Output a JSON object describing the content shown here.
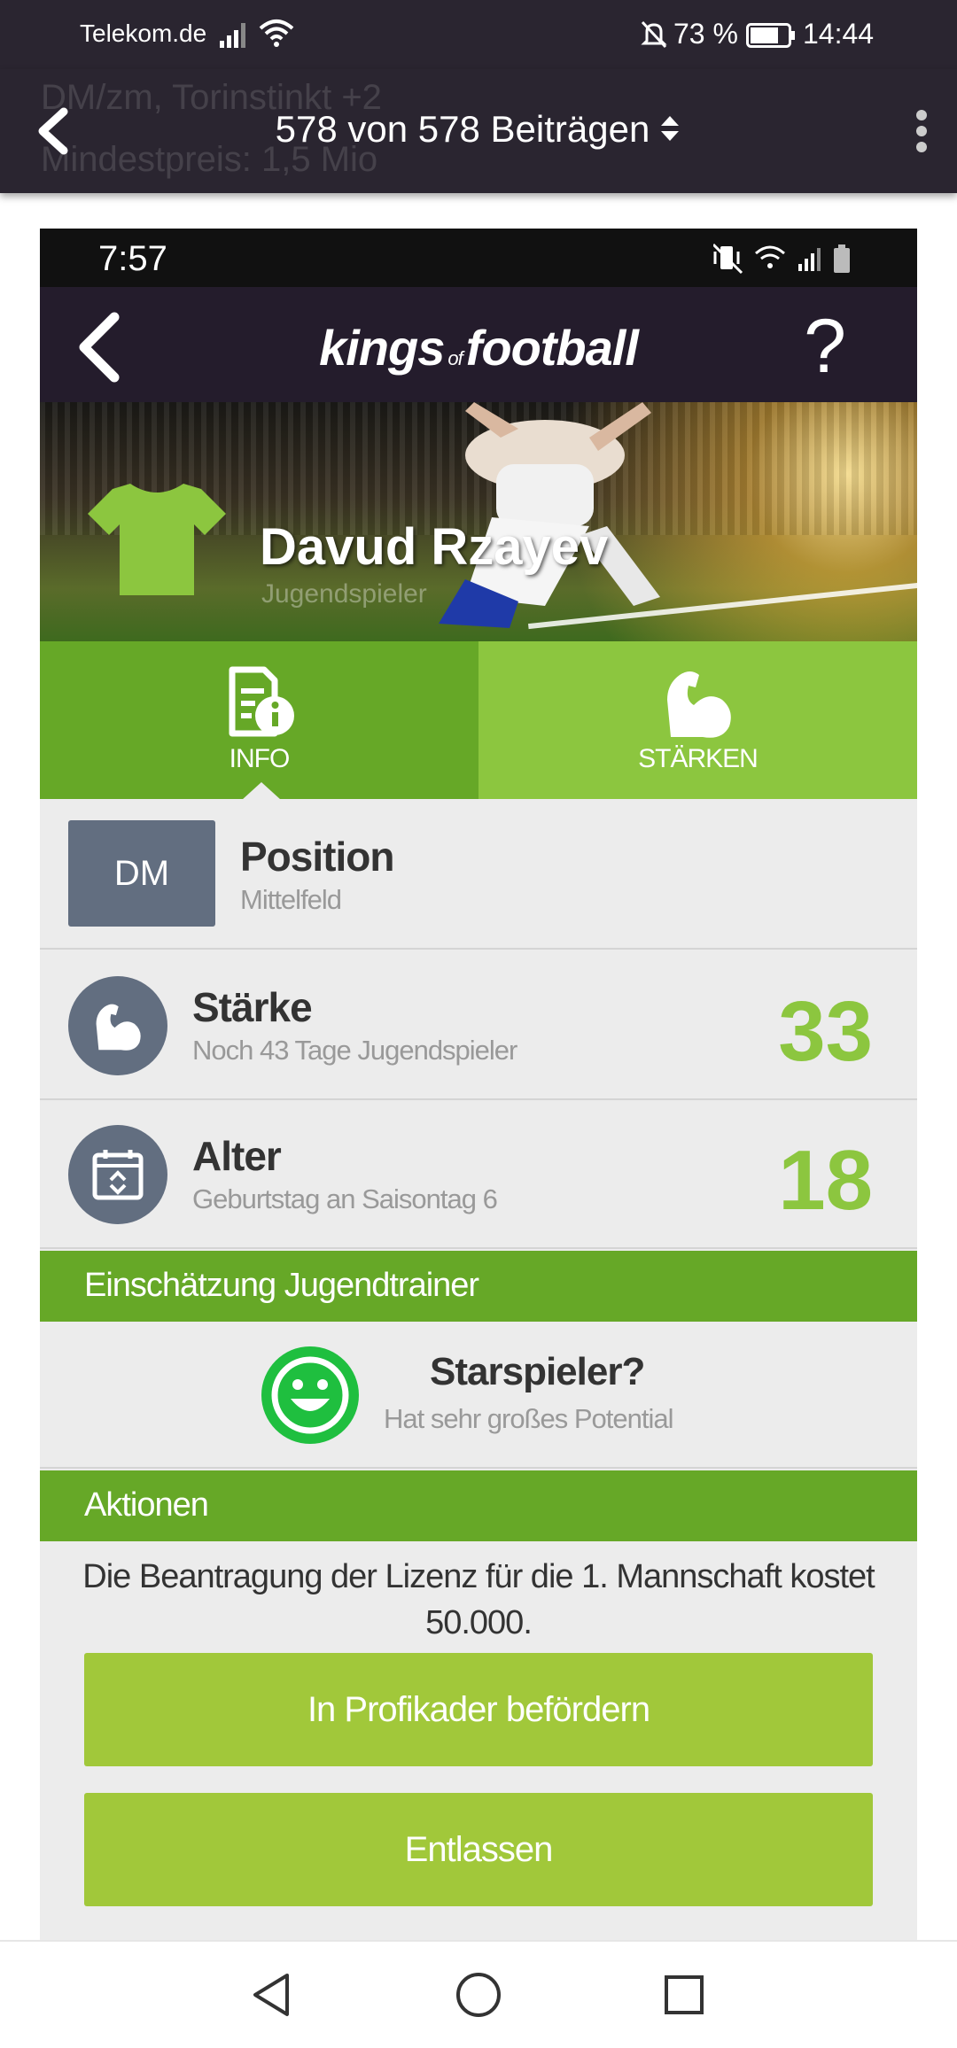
{
  "status_bar": {
    "carrier": "Telekom.de",
    "battery": "73 %",
    "time": "14:44"
  },
  "forum_header": {
    "ghost_line1": "DM/zm, Torinstinkt +2",
    "ghost_line2": "Mindestpreis: 1,5 Mio",
    "title": "578 von 578 Beiträgen"
  },
  "inner_status": {
    "time": "7:57"
  },
  "app": {
    "logo_left": "kings",
    "logo_of": "of",
    "logo_right": "football",
    "help": "?"
  },
  "player": {
    "name": "Davud Rzayev",
    "role": "Jugendspieler"
  },
  "tabs": [
    {
      "label": "INFO",
      "icon": "document-info-icon",
      "active": true
    },
    {
      "label": "STÄRKEN",
      "icon": "muscle-arm-icon",
      "active": false
    }
  ],
  "position": {
    "badge": "DM",
    "title": "Position",
    "subtitle": "Mittelfeld"
  },
  "strength": {
    "title": "Stärke",
    "subtitle": "Noch 43 Tage Jugendspieler",
    "value": "33"
  },
  "age": {
    "title": "Alter",
    "subtitle": "Geburtstag an Saisontag 6",
    "value": "18"
  },
  "trainer": {
    "header": "Einschätzung Jugendtrainer",
    "title": "Starspieler?",
    "subtitle": "Hat sehr großes Potential"
  },
  "actions": {
    "header": "Aktionen",
    "note": "Die Beantragung der Lizenz für die 1. Mannschaft kostet 50.000.",
    "promote_label": "In Profikader befördern",
    "release_label": "Entlassen"
  },
  "colors": {
    "dark_header": "#241c2c",
    "green_dark": "#66a827",
    "green_light": "#8cc63f",
    "button_green": "#a1c83a",
    "slate": "#626e80",
    "smiley_green": "#1fbf3f"
  }
}
